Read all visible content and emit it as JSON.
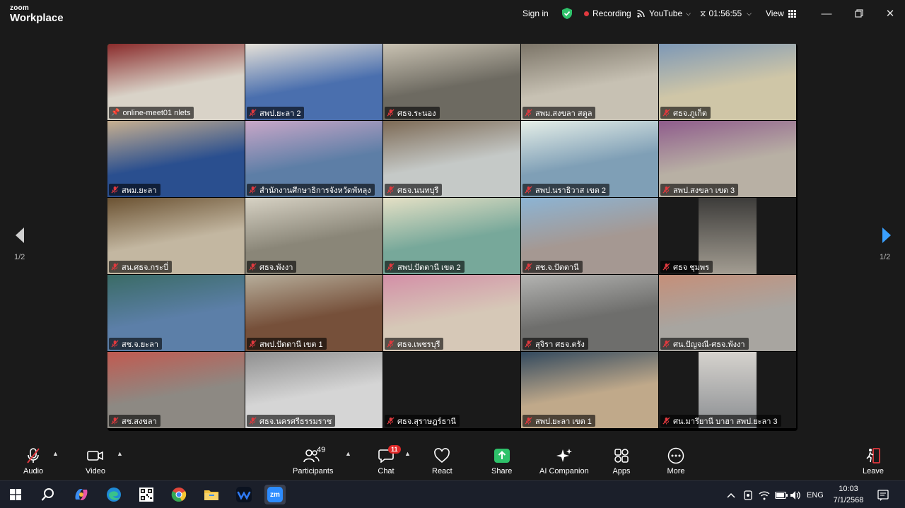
{
  "app": {
    "logo_line1": "zoom",
    "logo_line2": "Workplace"
  },
  "titlebar": {
    "sign_in": "Sign in",
    "recording": "Recording",
    "youtube": "YouTube",
    "timer": "01:56:55",
    "view": "View"
  },
  "gallery": {
    "page": "1/2",
    "page_right": "1/2",
    "tiles": [
      {
        "label": "online-meet01 nlets",
        "active": true
      },
      {
        "label": "สพป.ยะลา 2"
      },
      {
        "label": "ศธจ.ระนอง"
      },
      {
        "label": "สพม.สงขลา สตูล"
      },
      {
        "label": "ศธจ.ภูเก็ต"
      },
      {
        "label": "สพม.ยะลา"
      },
      {
        "label": "สำนักงานศึกษาธิการจังหวัดพัทลุง"
      },
      {
        "label": "ศธจ.นนทบุรี"
      },
      {
        "label": "สพป.นราธิวาส เขต 2"
      },
      {
        "label": "สพป.สงขลา เขต 3"
      },
      {
        "label": "สน.ศธจ.กระบี่"
      },
      {
        "label": "ศธจ.พังงา"
      },
      {
        "label": "สพป.ปัตตานี เขต 2"
      },
      {
        "label": "สช.จ.ปัตตานี"
      },
      {
        "label": "ศธจ ชุมพร"
      },
      {
        "label": "สช.จ.ยะลา"
      },
      {
        "label": "สพป.ปัตตานี เขต 1"
      },
      {
        "label": "ศธจ.เพชรบุรี"
      },
      {
        "label": "สุจิรา ศธจ.ตรัง"
      },
      {
        "label": "ศน.ปัญจณี-ศธจ.พังงา"
      },
      {
        "label": "สช.สงขลา"
      },
      {
        "label": "ศธจ.นครศรีธรรมราช"
      },
      {
        "label": "ศธจ.สุราษฎร์ธานี"
      },
      {
        "label": "สพป.ยะลา เขต 1"
      },
      {
        "label": "ศน.มารียานี บาฮา สพป.ยะลา 3"
      }
    ]
  },
  "toolbar": {
    "audio": "Audio",
    "video": "Video",
    "participants": "Participants",
    "participants_count": "49",
    "chat": "Chat",
    "chat_badge": "11",
    "react": "React",
    "share": "Share",
    "ai_companion": "AI Companion",
    "apps": "Apps",
    "more": "More",
    "leave": "Leave"
  },
  "taskbar": {
    "zoom_label": "zm",
    "lang": "ENG",
    "time": "10:03",
    "date": "7/1/2568"
  },
  "colors": {
    "active_speaker": "#2ec26a",
    "share_green": "#2ec26a",
    "muted_red": "#e0393e",
    "recording_dot": "#e0393e",
    "shield_green": "#2ec26a"
  }
}
